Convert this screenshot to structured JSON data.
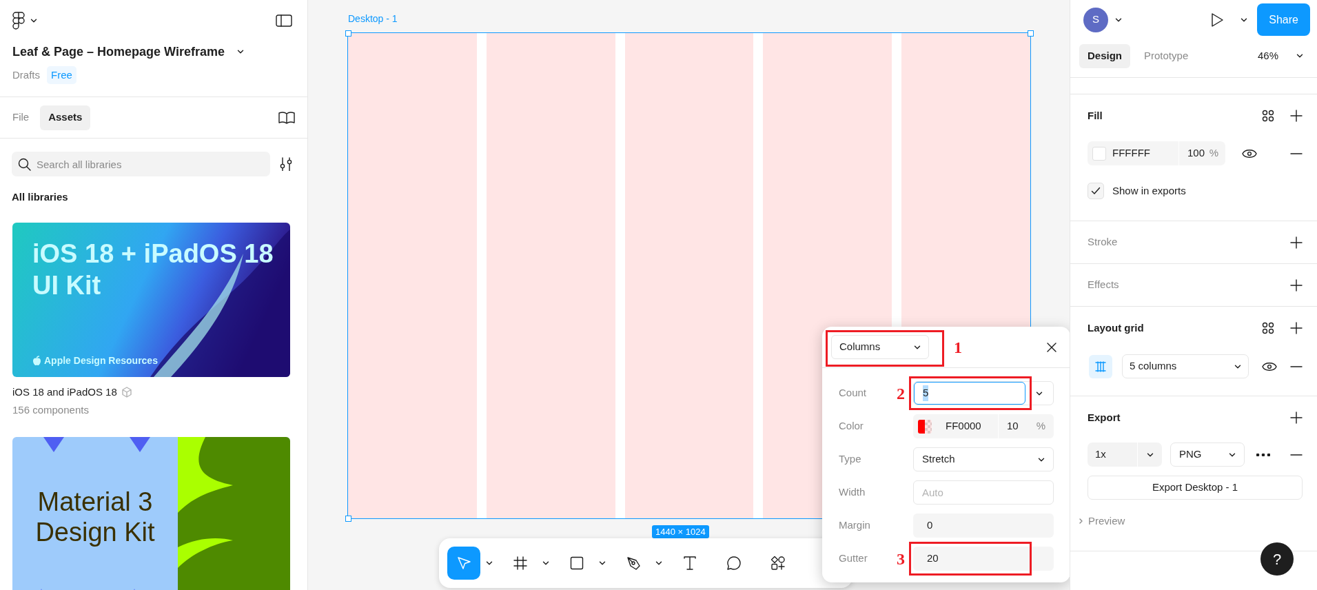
{
  "file": {
    "title": "Leaf & Page – Homepage Wireframe",
    "location": "Drafts",
    "plan": "Free"
  },
  "left_tabs": [
    {
      "label": "File",
      "selected": false
    },
    {
      "label": "Assets",
      "selected": true
    }
  ],
  "search": {
    "placeholder": "Search all libraries"
  },
  "libraries_heading": "All libraries",
  "libraries": [
    {
      "kind": "ios",
      "cover_lines": [
        "iOS 18 + iPadOS 18",
        "UI Kit"
      ],
      "cover_footer": "Apple Design Resources",
      "name": "iOS 18 and iPadOS 18",
      "count": "156 components"
    },
    {
      "kind": "material",
      "cover_lines": [
        "Material 3",
        "Design Kit"
      ]
    }
  ],
  "canvas": {
    "frame_label": "Desktop - 1",
    "frame_size": "1440 × 1024",
    "selected": true
  },
  "toolbar": [
    {
      "kind": "move",
      "selected": true,
      "menu": true
    },
    {
      "kind": "frame",
      "selected": false,
      "menu": true
    },
    {
      "kind": "rectangle",
      "selected": false,
      "menu": true
    },
    {
      "kind": "pen",
      "selected": false,
      "menu": true
    },
    {
      "kind": "text",
      "selected": false,
      "menu": false
    },
    {
      "kind": "comment",
      "selected": false,
      "menu": false
    },
    {
      "kind": "actions",
      "selected": false,
      "menu": false
    }
  ],
  "grid_popup": {
    "type": "Columns",
    "annotation": "1",
    "rows": [
      {
        "kind": "count",
        "label": "Count",
        "value": "5",
        "focused": true,
        "annotation": "2"
      },
      {
        "kind": "color",
        "label": "Color",
        "hex": "FF0000",
        "opacity": "10",
        "unit": "%"
      },
      {
        "kind": "select",
        "label": "Type",
        "value": "Stretch"
      },
      {
        "kind": "input",
        "label": "Width",
        "placeholder": "Auto"
      },
      {
        "kind": "number",
        "label": "Margin",
        "value": "0"
      },
      {
        "kind": "number",
        "label": "Gutter",
        "value": "20",
        "annotation": "3"
      }
    ]
  },
  "header": {
    "user_initial": "S",
    "share": "Share",
    "zoom": "46%"
  },
  "right_tabs": [
    {
      "label": "Design",
      "selected": true
    },
    {
      "label": "Prototype",
      "selected": false
    }
  ],
  "sections": [
    {
      "kind": "fill",
      "title": "Fill",
      "empty": false,
      "hex": "FFFFFF",
      "opacity": "100",
      "unit": "%",
      "option": {
        "label": "Show in exports",
        "checked": true
      }
    },
    {
      "kind": "stroke",
      "title": "Stroke",
      "empty": true
    },
    {
      "kind": "effects",
      "title": "Effects",
      "empty": true
    },
    {
      "kind": "grid",
      "title": "Layout grid",
      "empty": false,
      "value": "5 columns"
    },
    {
      "kind": "export",
      "title": "Export",
      "empty": false,
      "scale": "1x",
      "format": "PNG",
      "button": "Export Desktop - 1",
      "preview": "Preview"
    }
  ],
  "help": "?"
}
